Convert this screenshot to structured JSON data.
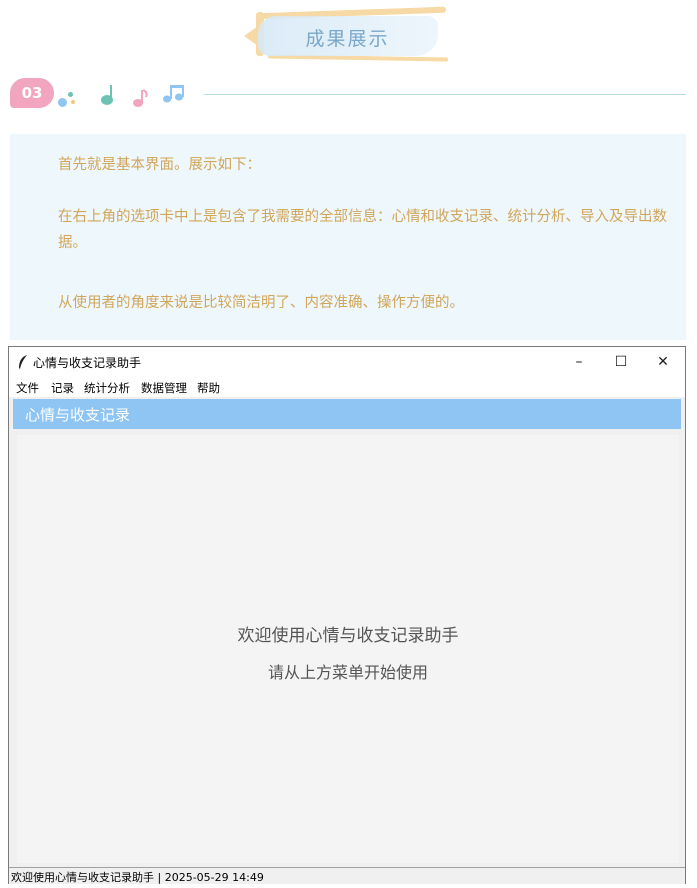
{
  "banner": {
    "title": "成果展示"
  },
  "section": {
    "number": "03"
  },
  "text_panel": {
    "para1": "首先就是基本界面。展示如下：",
    "para2": "在右上角的选项卡中上是包含了我需要的全部信息：心情和收支记录、统计分析、导入及导出数据。",
    "para3": "从使用者的角度来说是比较简洁明了、内容准确、操作方便的。"
  },
  "app": {
    "window_title": "心情与收支记录助手",
    "controls": {
      "minimize": "–",
      "maximize": "☐",
      "close": "✕"
    },
    "menu": [
      "文件",
      "记录",
      "统计分析",
      "数据管理",
      "帮助"
    ],
    "header_title": "心情与收支记录",
    "welcome_line1": "欢迎使用心情与收支记录助手",
    "welcome_line2": "请从上方菜单开始使用",
    "status": "欢迎使用心情与收支记录助手 | 2025-05-29 14:49"
  },
  "colors": {
    "accent_blue": "#8ec5f2",
    "text_gold": "#d1a65a",
    "badge_pink": "#f2a5bf",
    "panel_bg": "#eef7fc"
  }
}
